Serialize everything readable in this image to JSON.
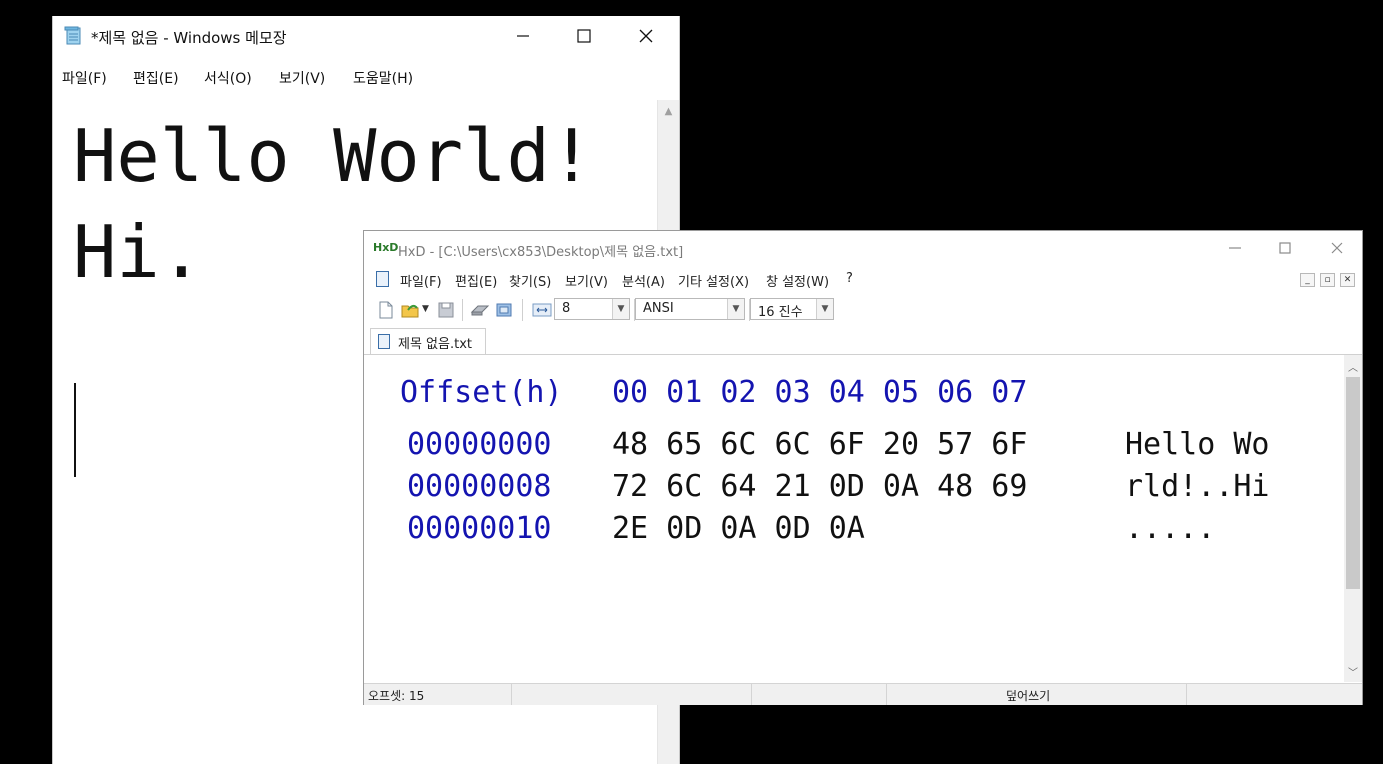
{
  "notepad": {
    "title": "*제목 없음 - Windows 메모장",
    "menu": [
      "파일(F)",
      "편집(E)",
      "서식(O)",
      "보기(V)",
      "도움말(H)"
    ],
    "content": "Hello World!\nHi."
  },
  "hxd": {
    "title": "HxD - [C:\\Users\\cx853\\Desktop\\제목 없음.txt]",
    "logo": "HxD",
    "menu": [
      "파일(F)",
      "편집(E)",
      "찾기(S)",
      "보기(V)",
      "분석(A)",
      "기타 설정(X)",
      "창 설정(W)",
      "?"
    ],
    "toolbar": {
      "bytes_per_row": "8",
      "charset": "ANSI",
      "base": "16 진수"
    },
    "tab": "제목 없음.txt",
    "header": {
      "offset_label": "Offset(h)",
      "columns": "00 01 02 03 04 05 06 07"
    },
    "rows": [
      {
        "offset": "00000000",
        "hex": "48 65 6C 6C 6F 20 57 6F",
        "text": "Hello Wo"
      },
      {
        "offset": "00000008",
        "hex": "72 6C 64 21 0D 0A 48 69",
        "text": "rld!..Hi"
      },
      {
        "offset": "00000010",
        "hex": "2E 0D 0A 0D 0A",
        "text": "....."
      }
    ],
    "status": {
      "offset": "오프셋: 15",
      "mode": "덮어쓰기"
    }
  },
  "colors": {
    "hex_offset_blue": "#1414b0",
    "background": "#000000"
  },
  "icons": [
    "notepad-icon",
    "minimize-icon",
    "maximize-icon",
    "close-icon",
    "new-file-icon",
    "open-file-icon",
    "save-icon",
    "disk-icon",
    "ram-icon",
    "columns-icon",
    "chevron-down-icon"
  ]
}
